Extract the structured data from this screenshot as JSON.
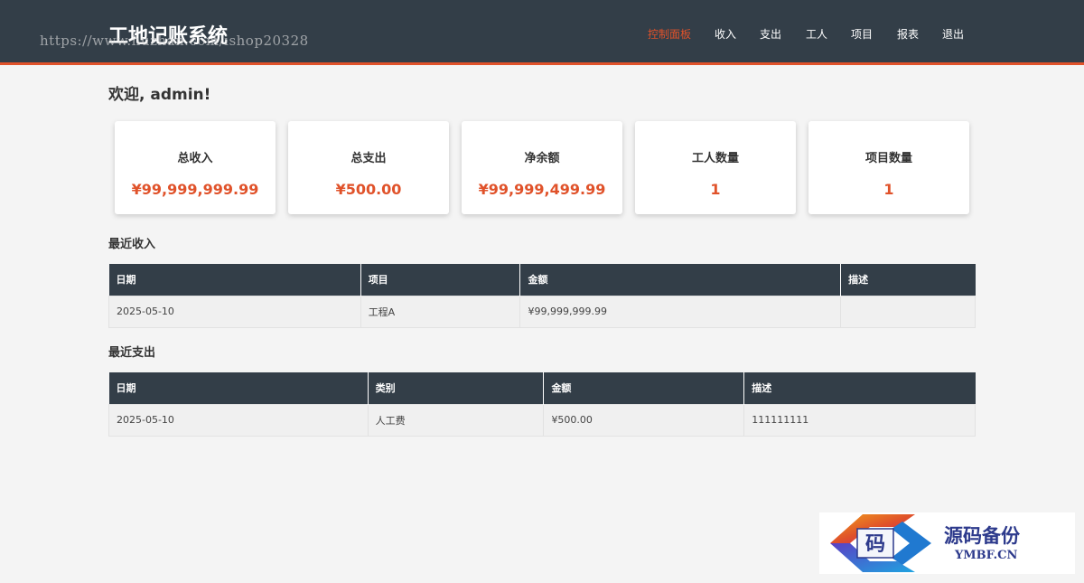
{
  "header": {
    "brand": "工地记账系统",
    "watermark": "https://www.huzhan.com/ishop20328",
    "nav": [
      {
        "label": "控制面板",
        "active": true
      },
      {
        "label": "收入",
        "active": false
      },
      {
        "label": "支出",
        "active": false
      },
      {
        "label": "工人",
        "active": false
      },
      {
        "label": "项目",
        "active": false
      },
      {
        "label": "报表",
        "active": false
      },
      {
        "label": "退出",
        "active": false
      }
    ]
  },
  "welcome": "欢迎, admin!",
  "stats": [
    {
      "label": "总收入",
      "value": "¥99,999,999.99"
    },
    {
      "label": "总支出",
      "value": "¥500.00"
    },
    {
      "label": "净余额",
      "value": "¥99,999,499.99"
    },
    {
      "label": "工人数量",
      "value": "1"
    },
    {
      "label": "项目数量",
      "value": "1"
    }
  ],
  "recent_income": {
    "title": "最近收入",
    "headers": [
      "日期",
      "项目",
      "金额",
      "描述"
    ],
    "rows": [
      [
        "2025-05-10",
        "工程A",
        "¥99,999,999.99",
        ""
      ]
    ]
  },
  "recent_expense": {
    "title": "最近支出",
    "headers": [
      "日期",
      "类别",
      "金额",
      "描述"
    ],
    "rows": [
      [
        "2025-05-10",
        "人工费",
        "¥500.00",
        "111111111"
      ]
    ]
  },
  "logo": {
    "glyph": "码",
    "name": "源码备份",
    "domain": "YMBF.CN"
  },
  "colors": {
    "header_bg": "#333e48",
    "accent": "#e0522a",
    "page_bg": "#f4f4f4"
  }
}
